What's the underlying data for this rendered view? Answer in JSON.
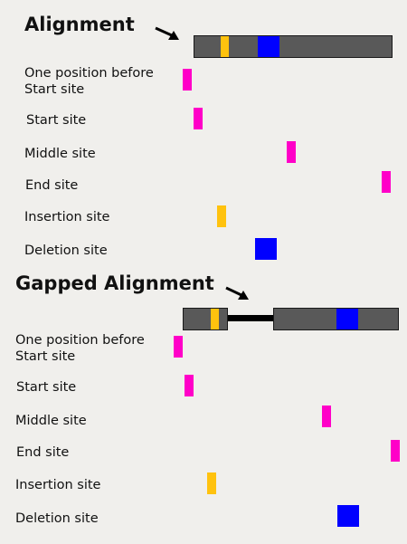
{
  "colors": {
    "background": "#f0efec",
    "bar_fill": "#595959",
    "bar_border": "#1a1a1a",
    "start_end_marker": "#ff00c8",
    "insertion_marker": "#ffc20e",
    "deletion_marker": "#0000ff",
    "connector": "#000000"
  },
  "alignment": {
    "title": "Alignment",
    "labels": {
      "one_before_line1": "One position before",
      "one_before_line2": "Start site",
      "start": "Start site",
      "middle": "Middle site",
      "end": "End site",
      "insertion": "Insertion site",
      "deletion": "Deletion site"
    }
  },
  "gapped_alignment": {
    "title": "Gapped Alignment",
    "labels": {
      "one_before_line1": "One position before",
      "one_before_line2": "Start site",
      "start": "Start site",
      "middle": "Middle site",
      "end": "End site",
      "insertion": "Insertion site",
      "deletion": "Deletion site"
    }
  },
  "icons": {
    "arrow": "arrow-pointing-right-down-icon"
  }
}
